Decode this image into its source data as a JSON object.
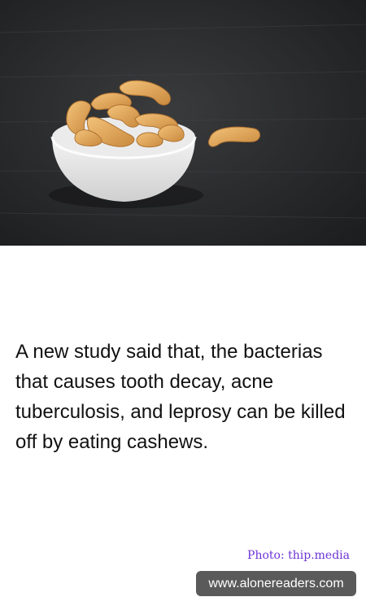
{
  "hero_image": {
    "subject": "cashew-bowl"
  },
  "fact": {
    "text": "A new study said that, the bacterias that causes tooth decay, acne tuberculosis, and leprosy can be killed off by eating cashews."
  },
  "credit": {
    "text": "Photo: thip.media"
  },
  "footer": {
    "site": "www.alonereaders.com"
  },
  "colors": {
    "credit": "#6b33d6",
    "badge_background": "#5a5a5a",
    "photo_background": "#2a2b2d"
  }
}
